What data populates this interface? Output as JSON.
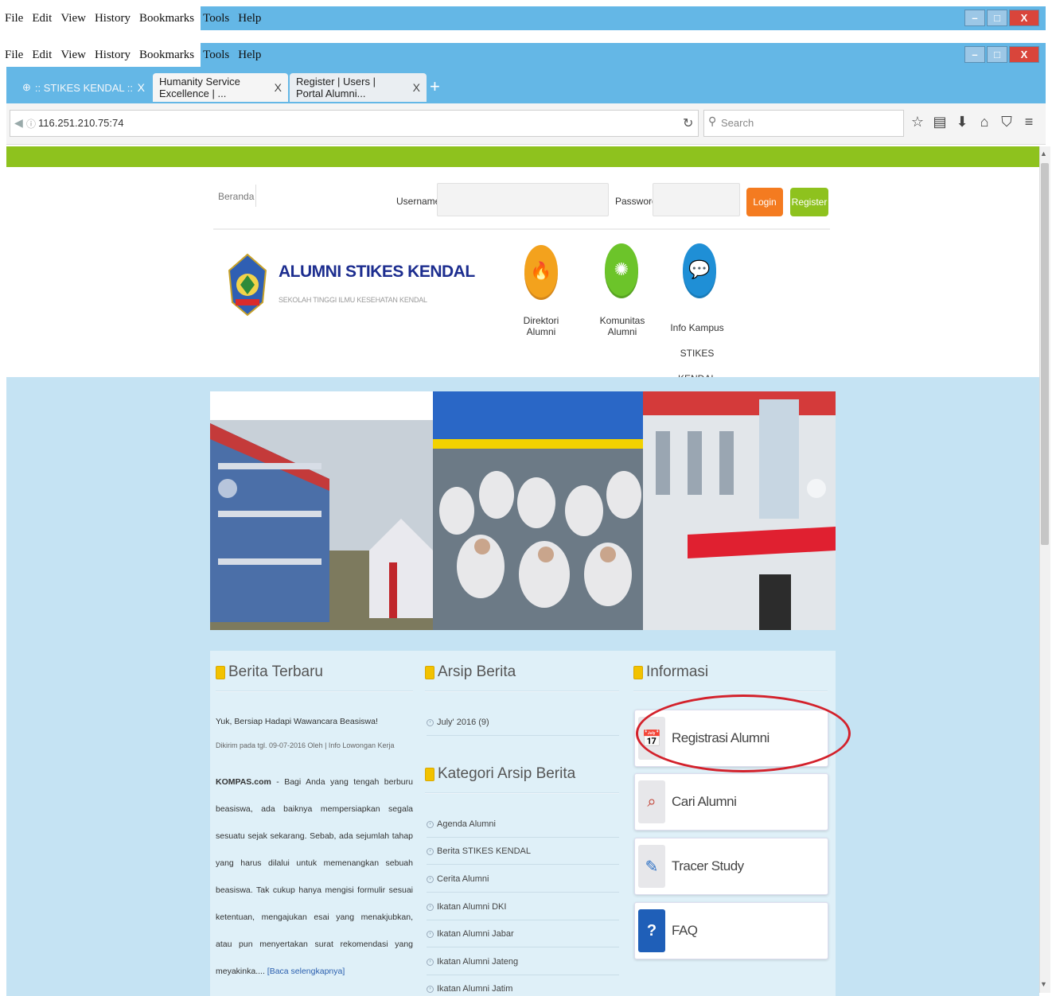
{
  "browser": {
    "menu": [
      "File",
      "Edit",
      "View",
      "History",
      "Bookmarks",
      "Tools",
      "Help"
    ],
    "window_buttons": [
      "–",
      "□",
      "X"
    ],
    "tabs": [
      {
        "title": ":: STIKES KENDAL ::"
      },
      {
        "title": "Humanity Service Excellence | ..."
      },
      {
        "title": "Register | Users | Portal Alumni..."
      }
    ],
    "tab_close": "X",
    "new_tab": "+",
    "url": "116.251.210.75:74",
    "search_placeholder": "Search",
    "icons": [
      "star-icon",
      "reader-icon",
      "download-icon",
      "home-icon",
      "shield-icon",
      "menu-icon"
    ]
  },
  "header": {
    "beranda": "Beranda",
    "username_label": "Username",
    "password_label": "Password",
    "login_label": "Login",
    "register_label": "Register"
  },
  "logo": {
    "title": "ALUMNI STIKES KENDAL",
    "subtitle": "SEKOLAH TINGGI ILMU KESEHATAN KENDAL"
  },
  "quicknav": [
    {
      "label": "Direktori Alumni",
      "color": "#f3a21d",
      "icon": "flame-icon"
    },
    {
      "label": "Komunitas Alumni",
      "color": "#6cc42a",
      "icon": "community-icon"
    },
    {
      "label": "Info Kampus STIKES KENDAL",
      "color": "#1f8fd6",
      "icon": "chat-icon"
    }
  ],
  "berita_terbaru": {
    "title": "Berita Terbaru",
    "headline": "Yuk, Bersiap Hadapi Wawancara Beasiswa!",
    "meta": "Dikirim pada tgl. 09-07-2016 Oleh | Info Lowongan Kerja",
    "source": "KOMPAS.com",
    "body": " - Bagi Anda yang tengah berburu beasiswa, ada baiknya mempersiapkan segala sesuatu sejak sekarang. Sebab, ada sejumlah tahap yang harus dilalui untuk memenangkan sebuah beasiswa. Tak cukup hanya mengisi formulir sesuai ketentuan, mengajukan esai yang menakjubkan, atau pun menyertakan surat rekomendasi yang meyakinka....",
    "more": "[Baca selengkapnya]"
  },
  "arsip_berita": {
    "title": "Arsip Berita",
    "items": [
      "July' 2016 (9)"
    ]
  },
  "kategori": {
    "title": "Kategori Arsip Berita",
    "items": [
      "Agenda Alumni",
      "Berita STIKES KENDAL",
      "Cerita Alumni",
      "Ikatan Alumni DKI",
      "Ikatan Alumni Jabar",
      "Ikatan Alumni Jateng",
      "Ikatan Alumni Jatim"
    ]
  },
  "informasi": {
    "title": "Informasi",
    "items": [
      {
        "label": "Registrasi Alumni",
        "icon": "calendar-icon"
      },
      {
        "label": "Cari Alumni",
        "icon": "search-person-icon"
      },
      {
        "label": "Tracer Study",
        "icon": "edit-icon"
      },
      {
        "label": "FAQ",
        "icon": "question-icon"
      }
    ]
  }
}
